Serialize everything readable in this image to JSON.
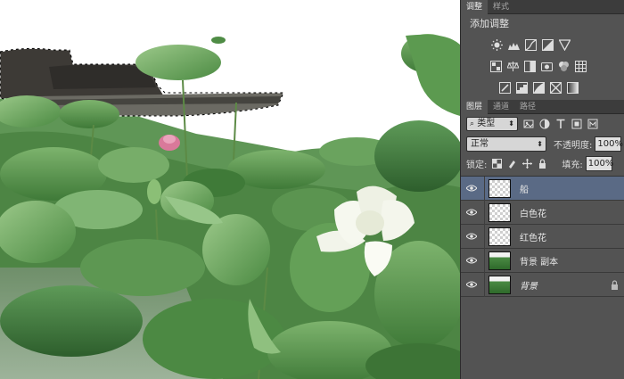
{
  "adjustments_panel": {
    "tabs": [
      "调整",
      "样式"
    ],
    "active_tab": 0,
    "title": "添加调整",
    "icons_row1": [
      "brightness-contrast-icon",
      "levels-icon",
      "curves-icon",
      "exposure-icon",
      "vibrance-icon"
    ],
    "icons_row2": [
      "hue-saturation-icon",
      "color-balance-icon",
      "black-white-icon",
      "photo-filter-icon",
      "channel-mixer-icon",
      "color-lookup-icon"
    ],
    "icons_row3": [
      "invert-icon",
      "posterize-icon",
      "threshold-icon",
      "selective-color-icon",
      "gradient-map-icon"
    ]
  },
  "layers_panel": {
    "tabs": [
      "图层",
      "通道",
      "路径"
    ],
    "active_tab": 0,
    "kind_filter": "类型",
    "blend_mode": "正常",
    "opacity_label": "不透明度:",
    "opacity_value": "100%",
    "lock_label": "锁定:",
    "fill_label": "填充:",
    "fill_value": "100%",
    "layers": [
      {
        "name": "船",
        "thumb": "checker",
        "selected": true,
        "locked": false
      },
      {
        "name": "白色花",
        "thumb": "checker",
        "selected": false,
        "locked": false
      },
      {
        "name": "红色花",
        "thumb": "checker",
        "selected": false,
        "locked": false
      },
      {
        "name": "背景 副本",
        "thumb": "photo",
        "selected": false,
        "locked": false
      },
      {
        "name": "背景",
        "thumb": "photo",
        "selected": false,
        "locked": true
      }
    ]
  },
  "colors": {
    "panel_bg": "#535353",
    "selected_layer": "#5a6a85",
    "leaf_green": "#4f8c45",
    "lotus_white": "#f5f7ee",
    "lotus_pink": "#d9799a",
    "boat_dark": "#3b3835"
  }
}
